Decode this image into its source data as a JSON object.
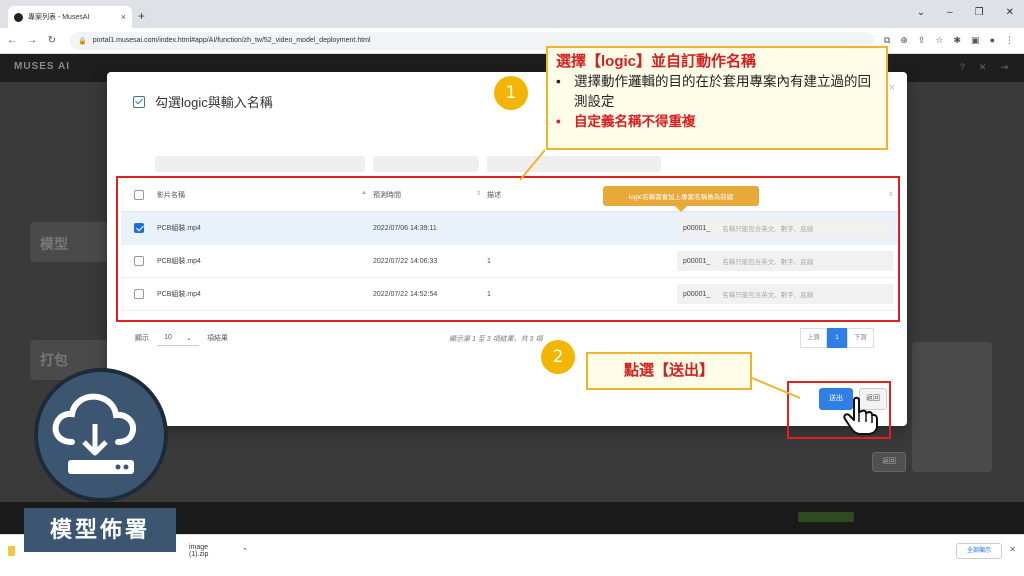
{
  "browser": {
    "tab_title": "專案列表 - MusesAI",
    "url": "portal1.musesai.com/index.html#app/AI/function/zh_tw/52_video_model_deployment.html",
    "new_tab": "+",
    "close_tab": "×"
  },
  "app": {
    "logo": "MUSES AI",
    "bg_label_1": "模型",
    "bg_label_2": "打包",
    "bg_back": "返回"
  },
  "modal": {
    "title": "勾選logic與輸入名稱",
    "columns": {
      "name": "影片名稱",
      "time": "預測時間",
      "desc": "描述"
    },
    "rows": [
      {
        "checked": true,
        "name": "PCB組裝.mp4",
        "time": "2022/07/06 14:39:11",
        "desc": "",
        "logic": "p00001_",
        "placeholder": "名稱只能包含英文、數字、底線"
      },
      {
        "checked": false,
        "name": "PCB組裝.mp4",
        "time": "2022/07/22 14:06:33",
        "desc": "1",
        "logic": "p00001_",
        "placeholder": "名稱只能包含英文、數字、底線"
      },
      {
        "checked": false,
        "name": "PCB組裝.mp4",
        "time": "2022/07/22 14:52:54",
        "desc": "1",
        "logic": "p00001_",
        "placeholder": "名稱只能包含英文、數字、底線"
      }
    ],
    "tooltip": "logic名稱需會加上專案名稱做為前綴",
    "pager": {
      "show": "顯示",
      "size": "10",
      "unit": "項結果",
      "info": "顯示第 1 至 3 項結果，共 3 項",
      "prev": "上頁",
      "current": "1",
      "next": "下頁"
    },
    "submit": "送出",
    "back": "返回"
  },
  "annotations": {
    "step1_num": "1",
    "step1_title": "選擇【logic】並自訂動作名稱",
    "step1_bullet1": "選擇動作邏輯的目的在於套用專案內有建立過的回測設定",
    "step1_bullet2": "自定義名稱不得重複",
    "step2_num": "2",
    "step2_text": "點選【送出】"
  },
  "badge": {
    "label": "模型佈署"
  },
  "download": {
    "filename": "image (1).zip",
    "show_all": "全部顯示"
  },
  "colors": {
    "primary": "#2f7fe6",
    "annotation_red": "#e02020",
    "callout_border": "#f0b429",
    "step_circle": "#f2b600",
    "tooltip": "#e8a83a",
    "badge": "#3c5671"
  }
}
